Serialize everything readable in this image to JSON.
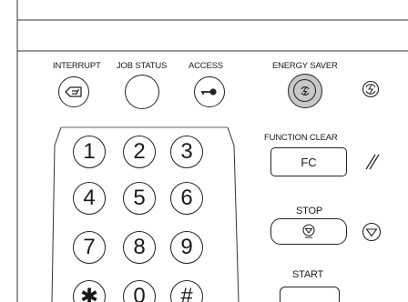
{
  "top_labels": {
    "interrupt": "INTERRUPT",
    "job_status": "JOB STATUS",
    "access": "ACCESS",
    "energy_saver": "ENERGY SAVER"
  },
  "function_clear": {
    "label": "FUNCTION CLEAR",
    "button_text": "FC"
  },
  "stop": {
    "label": "STOP"
  },
  "start": {
    "label": "START"
  },
  "keypad": [
    "1",
    "2",
    "3",
    "4",
    "5",
    "6",
    "7",
    "8",
    "9",
    "✱",
    "0",
    "#"
  ],
  "icons": {
    "interrupt": "interrupt-icon",
    "access": "key-icon",
    "energy_saver": "energy-saver-icon",
    "function_clear": "function-clear-icon",
    "stop": "stop-icon"
  }
}
